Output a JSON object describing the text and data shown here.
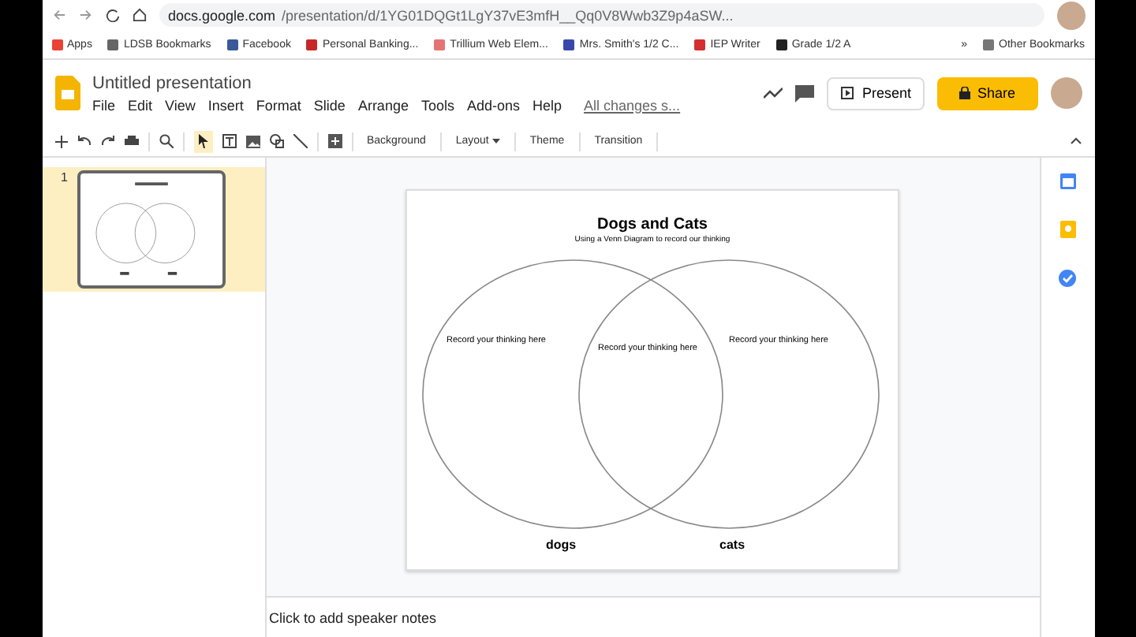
{
  "browser": {
    "url_host": "docs.google.com",
    "url_path": "/presentation/d/1YG01DQGt1LgY37vE3mfH__Qq0V8Wwb3Z9p4aSW...",
    "bookmarks": [
      "Apps",
      "LDSB Bookmarks",
      "Facebook",
      "Personal Banking...",
      "Trillium Web Elem...",
      "Mrs. Smith's 1/2 C...",
      "IEP Writer",
      "Grade 1/2 A"
    ],
    "more": "»",
    "other_bookmarks": "Other Bookmarks"
  },
  "document": {
    "title": "Untitled presentation",
    "menu": [
      "File",
      "Edit",
      "View",
      "Insert",
      "Format",
      "Slide",
      "Arrange",
      "Tools",
      "Add-ons",
      "Help"
    ],
    "save_status": "All changes s...",
    "present": "Present",
    "share": "Share"
  },
  "toolbar": {
    "buttons": [
      {
        "label": "Background",
        "dropdown": false
      },
      {
        "label": "Layout",
        "dropdown": true
      },
      {
        "label": "Theme",
        "dropdown": false
      },
      {
        "label": "Transition",
        "dropdown": false
      }
    ]
  },
  "filmstrip": [
    {
      "number": "1",
      "selected": true
    }
  ],
  "slide": {
    "title": "Dogs and Cats",
    "subtitle": "Using a Venn Diagram to record our thinking",
    "regions": [
      "Record your thinking here",
      "Record your thinking here",
      "Record your thinking here"
    ],
    "labels": [
      "dogs",
      "cats"
    ]
  },
  "notes": {
    "placeholder": "Click to add speaker notes"
  }
}
